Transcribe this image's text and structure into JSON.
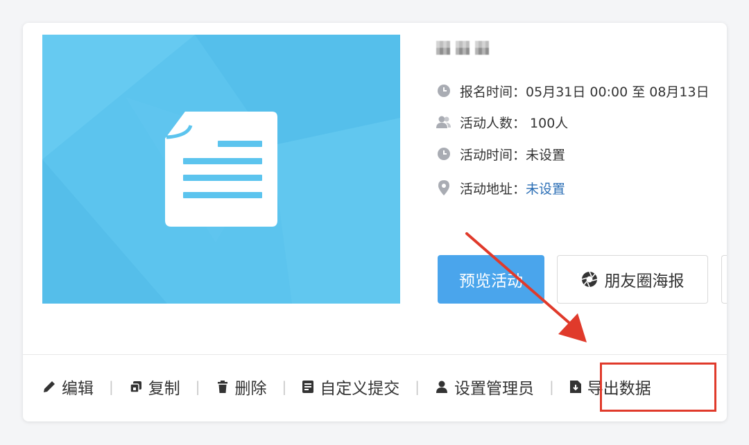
{
  "activity": {
    "info": {
      "signup_label": "报名时间：",
      "signup_value": "05月31日 00:00 至 08月13日",
      "count_label": "活动人数：",
      "count_value": "100人",
      "time_label": "活动时间：",
      "time_value": "未设置",
      "address_label": "活动地址：",
      "address_value": "未设置"
    },
    "buttons": {
      "preview": "预览活动",
      "poster": "朋友圈海报"
    }
  },
  "actions": {
    "edit": "编辑",
    "copy": "复制",
    "delete": "删除",
    "custom_submit": "自定义提交",
    "set_admin": "设置管理员",
    "export": "导出数据",
    "separator": "|"
  },
  "colors": {
    "primary": "#4aa5ec",
    "link": "#2c6fb6",
    "highlight": "#e03a2b",
    "cover_bg": "#5cc4ee"
  },
  "icons": [
    "clock-icon",
    "users-icon",
    "clock-icon",
    "location-pin-icon",
    "camera-aperture-icon",
    "pencil-icon",
    "copy-icon",
    "trash-icon",
    "form-icon",
    "user-icon",
    "download-icon",
    "document-icon"
  ]
}
